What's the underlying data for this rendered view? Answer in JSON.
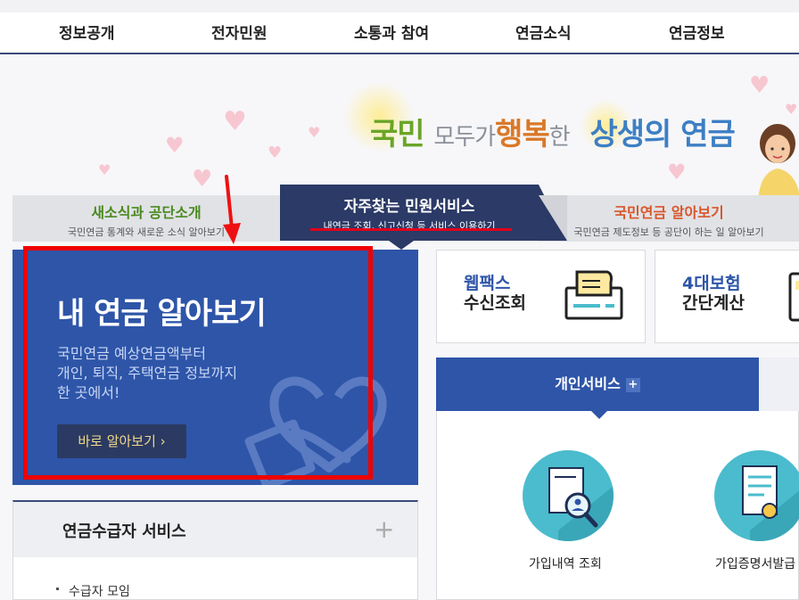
{
  "nav": [
    "정보공개",
    "전자민원",
    "소통과 참여",
    "연금소식",
    "연금정보"
  ],
  "slogan": {
    "p1": "국민",
    "p2": "모두가",
    "p3": "행복",
    "p4": "한",
    "p5": "상생의 연금"
  },
  "tabs": {
    "left": {
      "title": "새소식과 공단소개",
      "sub": "국민연금 통계와 새로운 소식 알아보기"
    },
    "center": {
      "title": "자주찾는 민원서비스",
      "sub": "내연금 조회, 신고신청 등 서비스 이용하기"
    },
    "right": {
      "title": "국민연금 알아보기",
      "sub": "국민연금 제도정보 등 공단이 하는 일 알아보기"
    }
  },
  "card": {
    "title": "내 연금 알아보기",
    "desc_lines": [
      "국민연금 예상연금액부터",
      "개인, 퇴직, 주택연금 정보까지",
      "한 곳에서!"
    ],
    "button": "바로 알아보기 ›"
  },
  "quick": [
    {
      "l1": "웹팩스",
      "l2": "수신조회",
      "icon": "fax-icon"
    },
    {
      "l1": "4대보험",
      "l2": "간단계산",
      "icon": "calculator-icon"
    }
  ],
  "services": {
    "tab": "개인서비스",
    "plus": "+",
    "items": [
      "가입내역 조회",
      "가입증명서발급"
    ]
  },
  "lower": {
    "title": "연금수급자 서비스",
    "plus": "+",
    "items": [
      "수급자 모임"
    ]
  },
  "colors": {
    "navy": "#2b3a66",
    "blue": "#2e55a8",
    "red": "#ee0000",
    "teal": "#4bbccd"
  }
}
